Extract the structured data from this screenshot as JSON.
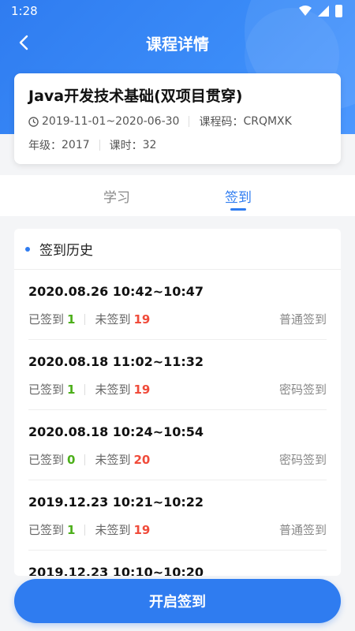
{
  "status_bar": {
    "time": "1:28"
  },
  "nav": {
    "title": "课程详情"
  },
  "course": {
    "title": "Java开发技术基础(双项目贯穿)",
    "date_range": "2019-11-01~2020-06-30",
    "code_label": "课程码：",
    "code": "CRQMXK",
    "grade_label": "年级：",
    "grade": "2017",
    "hours_label": "课时：",
    "hours": "32"
  },
  "tabs": [
    {
      "label": "学习",
      "active": false
    },
    {
      "label": "签到",
      "active": true
    }
  ],
  "history": {
    "title": "签到历史",
    "signed_label": "已签到",
    "unsigned_label": "未签到",
    "records": [
      {
        "time": "2020.08.26  10:42~10:47",
        "signed": "1",
        "unsigned": "19",
        "type": "普通签到"
      },
      {
        "time": "2020.08.18  11:02~11:32",
        "signed": "1",
        "unsigned": "19",
        "type": "密码签到"
      },
      {
        "time": "2020.08.18  10:24~10:54",
        "signed": "0",
        "unsigned": "20",
        "type": "密码签到"
      },
      {
        "time": "2019.12.23  10:21~10:22",
        "signed": "1",
        "unsigned": "19",
        "type": "普通签到"
      },
      {
        "time": "2019.12.23  10:10~10:20",
        "signed": "",
        "unsigned": "",
        "type": ""
      }
    ]
  },
  "action": {
    "start_label": "开启签到"
  },
  "colors": {
    "primary": "#2f7cf0",
    "green": "#4caf1a",
    "red": "#f04b3a"
  }
}
